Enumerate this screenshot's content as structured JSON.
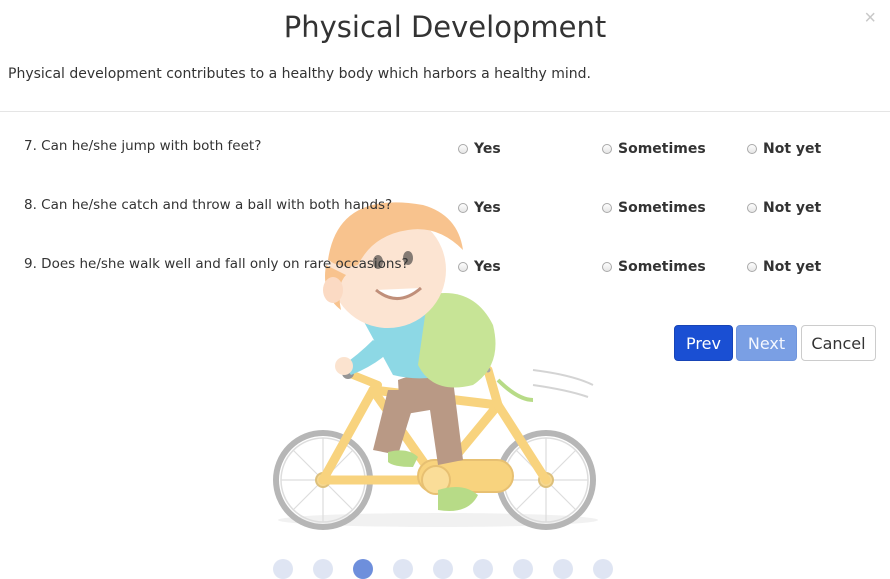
{
  "modal": {
    "title": "Physical Development",
    "close_symbol": "×",
    "subtitle": "Physical development contributes to a healthy body which harbors a healthy mind."
  },
  "questions": [
    {
      "text": "7. Can he/she jump with both feet?",
      "options": [
        "Yes",
        "Sometimes",
        "Not yet"
      ]
    },
    {
      "text": "8. Can he/she catch and throw a ball with both hands?",
      "options": [
        "Yes",
        "Sometimes",
        "Not yet"
      ]
    },
    {
      "text": "9. Does he/she walk well and fall only on rare occasions?",
      "options": [
        "Yes",
        "Sometimes",
        "Not yet"
      ]
    }
  ],
  "buttons": {
    "prev": "Prev",
    "next": "Next",
    "cancel": "Cancel"
  },
  "pagination": {
    "total_pages": 9,
    "current_page": 3
  },
  "colors": {
    "primary": "#1a4fd3",
    "primary_disabled": "#7a9fe4",
    "dot": "#dfe5f3",
    "dot_active": "#6e8fdc"
  },
  "illustration": "boy-riding-bicycle"
}
